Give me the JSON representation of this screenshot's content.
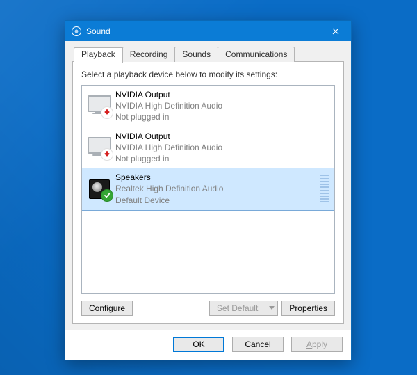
{
  "window": {
    "title": "Sound",
    "close_name": "close-icon"
  },
  "tabs": [
    "Playback",
    "Recording",
    "Sounds",
    "Communications"
  ],
  "active_tab": 0,
  "instruction": "Select a playback device below to modify its settings:",
  "devices": [
    {
      "name": "NVIDIA Output",
      "driver": "NVIDIA High Definition Audio",
      "status": "Not plugged in",
      "icon": "monitor",
      "badge": "unplugged",
      "selected": false,
      "meter": false
    },
    {
      "name": "NVIDIA Output",
      "driver": "NVIDIA High Definition Audio",
      "status": "Not plugged in",
      "icon": "monitor",
      "badge": "unplugged",
      "selected": false,
      "meter": false
    },
    {
      "name": "Speakers",
      "driver": "Realtek High Definition Audio",
      "status": "Default Device",
      "icon": "speaker",
      "badge": "default",
      "selected": true,
      "meter": true
    }
  ],
  "buttons": {
    "configure": "Configure",
    "set_default": "Set Default",
    "set_default_enabled": false,
    "properties": "Properties",
    "ok": "OK",
    "cancel": "Cancel",
    "apply": "Apply",
    "apply_enabled": false
  },
  "colors": {
    "accent": "#0b7cd6",
    "selection": "#cfe8ff"
  }
}
